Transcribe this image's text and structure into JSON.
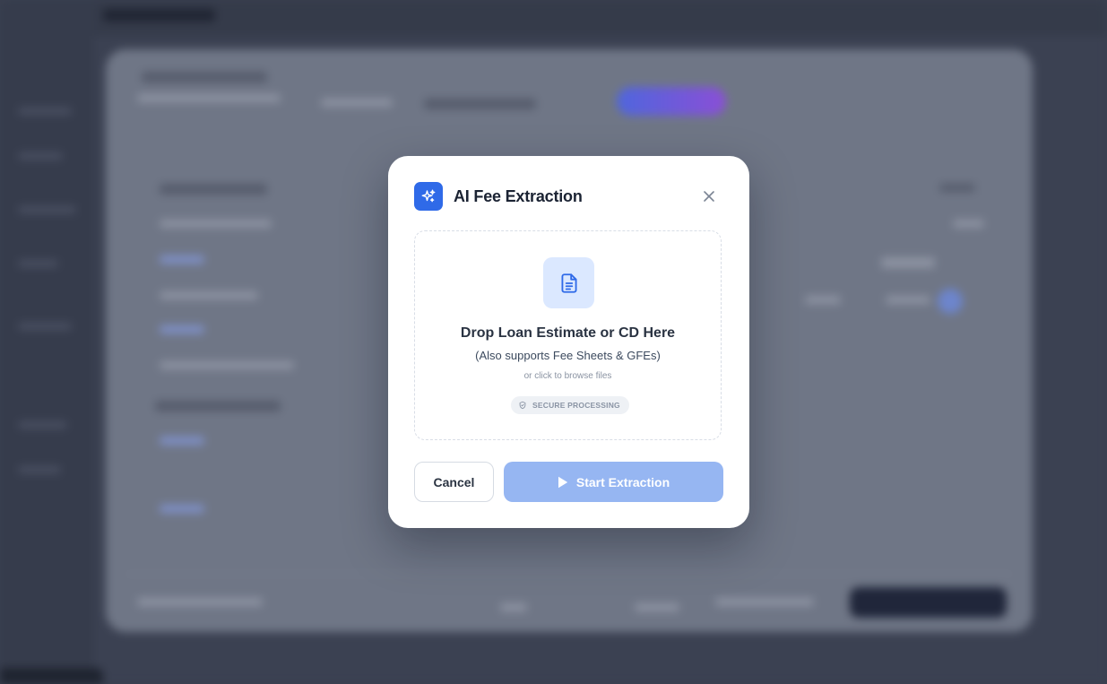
{
  "modal": {
    "title": "AI Fee Extraction",
    "header_icon": "sparkles-icon",
    "close_icon": "close-icon",
    "dropzone": {
      "icon": "document-icon",
      "title": "Drop Loan Estimate or CD Here",
      "subtitle": "(Also supports Fee Sheets & GFEs)",
      "hint": "or click to browse files",
      "badge_icon": "shield-icon",
      "badge_label": "SECURE PROCESSING"
    },
    "buttons": {
      "cancel_label": "Cancel",
      "start_label": "Start Extraction",
      "start_icon": "play-icon"
    }
  },
  "colors": {
    "accent": "#2f6ae8",
    "start_button_disabled": "#96b6f2",
    "doc_icon_bg": "#dbe8ff",
    "overlay": "#3b4152"
  }
}
